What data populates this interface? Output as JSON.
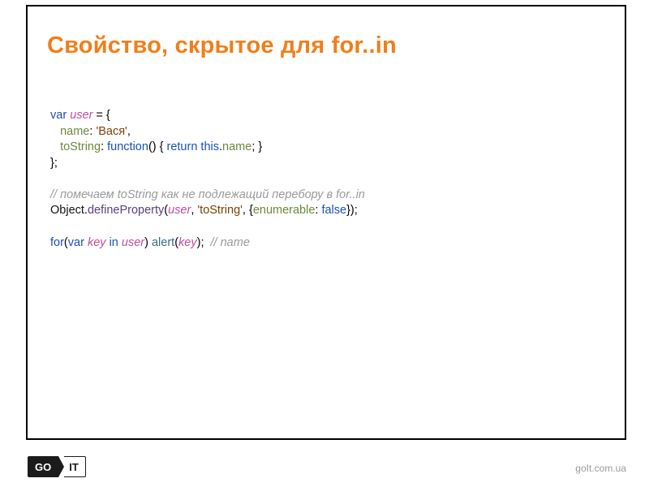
{
  "title": "Свойство, скрытое для for..in",
  "code": {
    "l1": {
      "var": "var",
      "user": "user",
      "eq": " = {"
    },
    "l2": {
      "name": "name",
      "colon": ": ",
      "str": "'Вася'",
      "comma": ","
    },
    "l3": {
      "toString": "toString",
      "colon": ": ",
      "function": "function",
      "parens": "() { ",
      "return": "return",
      "sp": " ",
      "this": "this",
      "dot": ".",
      "nameProp": "name",
      "tail": "; }"
    },
    "l4": "};",
    "l6": "// помечаем toString как не подлежащий перебору в for..in",
    "l7": {
      "obj": "Object",
      "dot": ".",
      "method": "defineProperty",
      "open": "(",
      "user": "user",
      "c1": ", ",
      "str": "'toString'",
      "c2": ", {",
      "enum": "enumerable",
      "c3": ": ",
      "false": "false",
      "close": "});"
    },
    "l9": {
      "for": "for",
      "open": "(",
      "var": "var",
      "sp1": " ",
      "key": "key",
      "sp2": " ",
      "in": "in",
      "sp3": " ",
      "user": "user",
      "close": ") ",
      "alert": "alert",
      "open2": "(",
      "key2": "key",
      "close2": ");",
      "sp4": "  ",
      "comment": "// name"
    }
  },
  "footer": {
    "logo_go": "GO",
    "logo_it": "IT",
    "site": "goIt.com.ua"
  }
}
